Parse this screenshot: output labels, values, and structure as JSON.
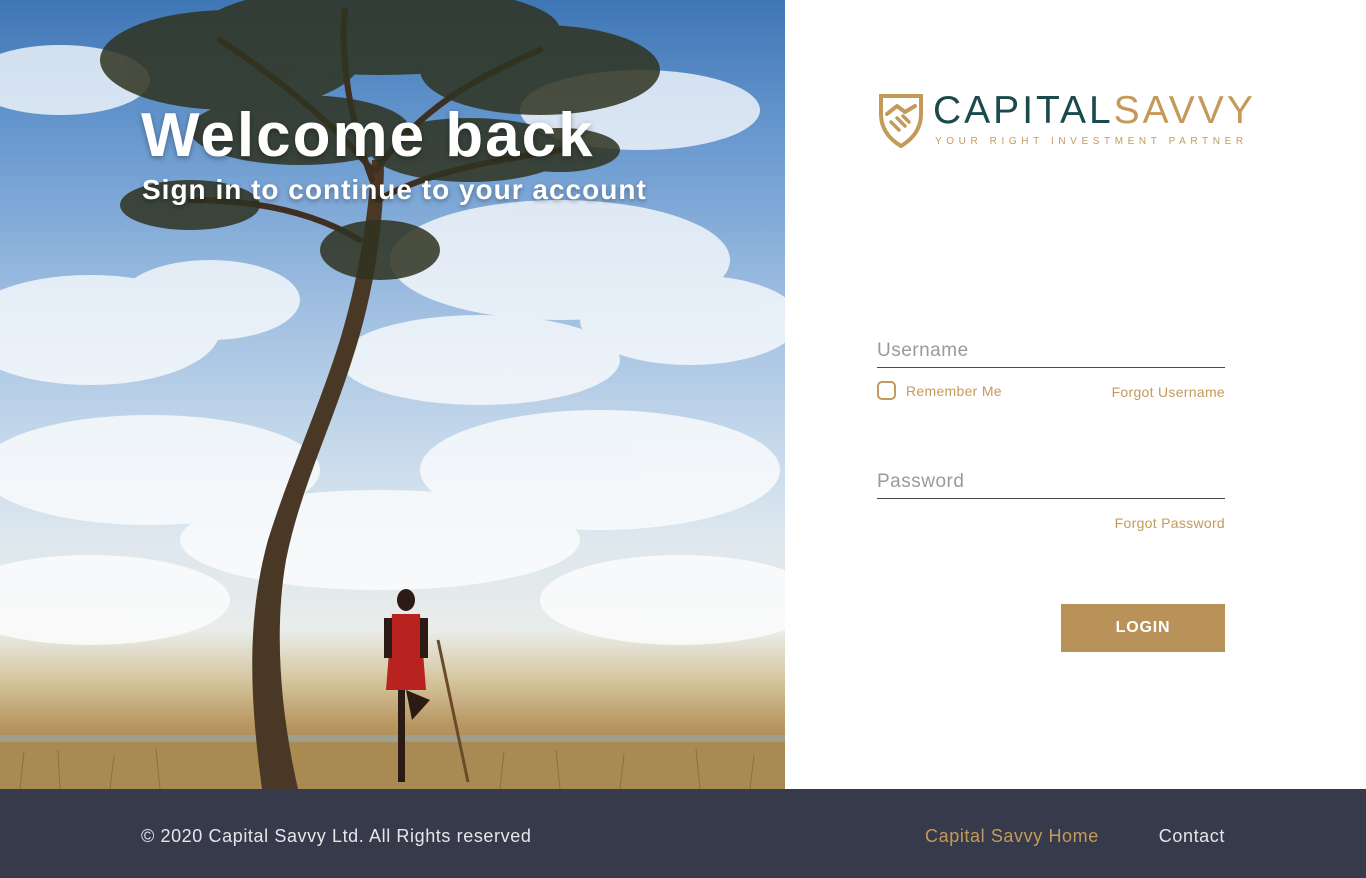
{
  "hero": {
    "title": "Welcome back",
    "subtitle": "Sign in to continue to your account"
  },
  "brand": {
    "name_part1": "CAPITAL",
    "name_part2": "SAVVY",
    "tagline": "YOUR RIGHT INVESTMENT PARTNER",
    "logo_icon": "handshake-shield-icon"
  },
  "login_form": {
    "username_placeholder": "Username",
    "username_value": "",
    "remember_me_label": "Remember Me",
    "remember_me_checked": false,
    "forgot_username": "Forgot Username",
    "password_placeholder": "Password",
    "password_value": "",
    "forgot_password": "Forgot Password",
    "login_button": "LOGIN"
  },
  "footer": {
    "copyright": "© 2020 Capital Savvy Ltd. All Rights reserved",
    "links": [
      "Capital Savvy Home",
      "Contact"
    ]
  },
  "colors": {
    "brand_gold": "#c49a5a",
    "brand_teal": "#1b4a4c",
    "button_gold": "#b9925a",
    "footer_bg": "#373a4a"
  }
}
